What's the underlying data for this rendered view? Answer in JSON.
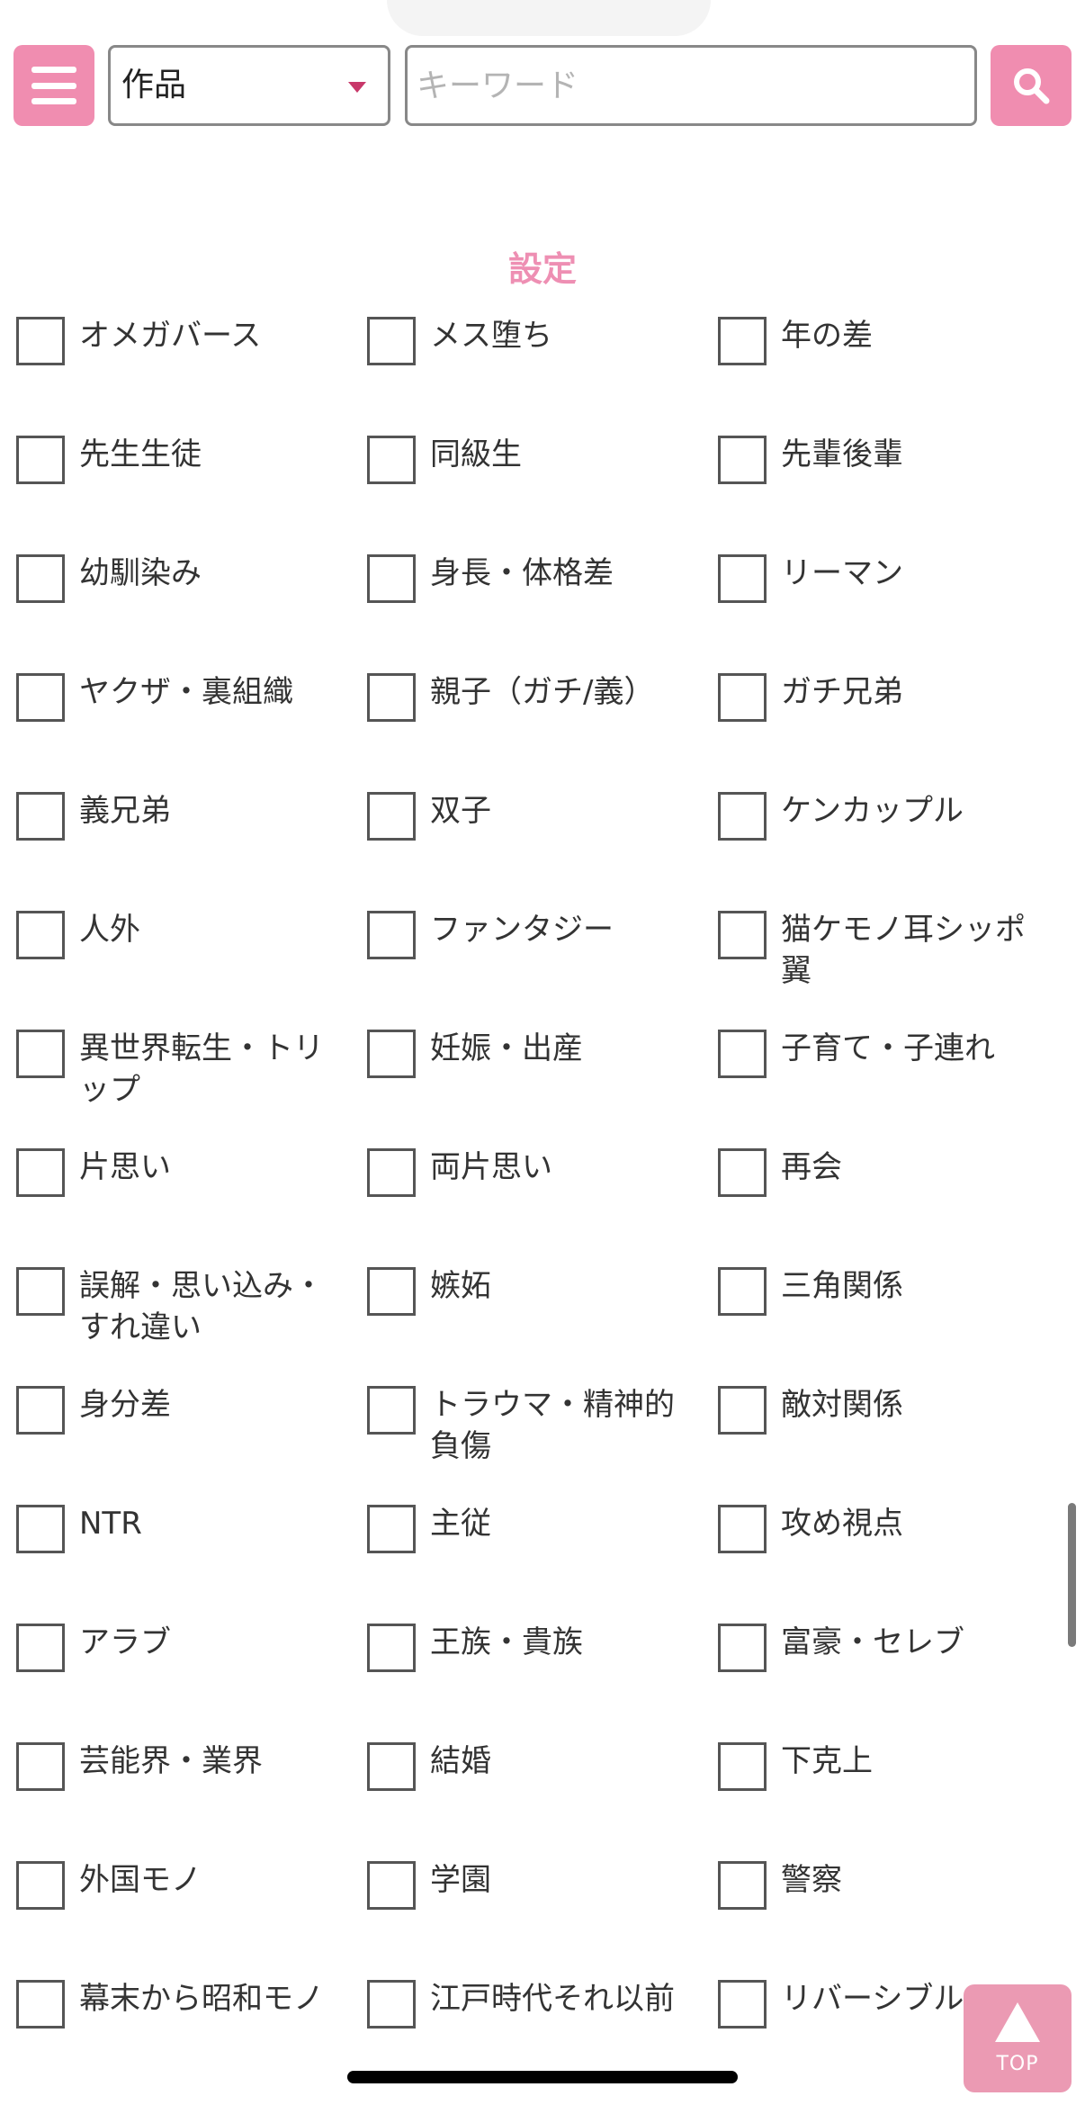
{
  "header": {
    "category_select": "作品",
    "search_placeholder": "キーワード",
    "search_value": ""
  },
  "section": {
    "title": "設定"
  },
  "tags": [
    [
      "オメガバース",
      "メス堕ち",
      "年の差"
    ],
    [
      "先生生徒",
      "同級生",
      "先輩後輩"
    ],
    [
      "幼馴染み",
      "身長・体格差",
      "リーマン"
    ],
    [
      "ヤクザ・裏組織",
      "親子（ガチ/義）",
      "ガチ兄弟"
    ],
    [
      "義兄弟",
      "双子",
      "ケンカップル"
    ],
    [
      "人外",
      "ファンタジー",
      "猫ケモノ耳シッポ翼"
    ],
    [
      "異世界転生・トリップ",
      "妊娠・出産",
      "子育て・子連れ"
    ],
    [
      "片思い",
      "両片思い",
      "再会"
    ],
    [
      "誤解・思い込み・すれ違い",
      "嫉妬",
      "三角関係"
    ],
    [
      "身分差",
      "トラウマ・精神的負傷",
      "敵対関係"
    ],
    [
      "NTR",
      "主従",
      "攻め視点"
    ],
    [
      "アラブ",
      "王族・貴族",
      "富豪・セレブ"
    ],
    [
      "芸能界・業界",
      "結婚",
      "下克上"
    ],
    [
      "外国モノ",
      "学園",
      "警察"
    ],
    [
      "幕末から昭和モノ",
      "江戸時代それ以前",
      "リバーシブル"
    ]
  ],
  "top_button": {
    "label": "TOP"
  },
  "colors": {
    "accent_pink": "#f08db0",
    "title_pink": "#ee8fb3",
    "caret": "#c8386a"
  },
  "icons": {
    "menu": "hamburger-icon",
    "search": "magnifier-icon",
    "top": "up-triangle-icon"
  }
}
